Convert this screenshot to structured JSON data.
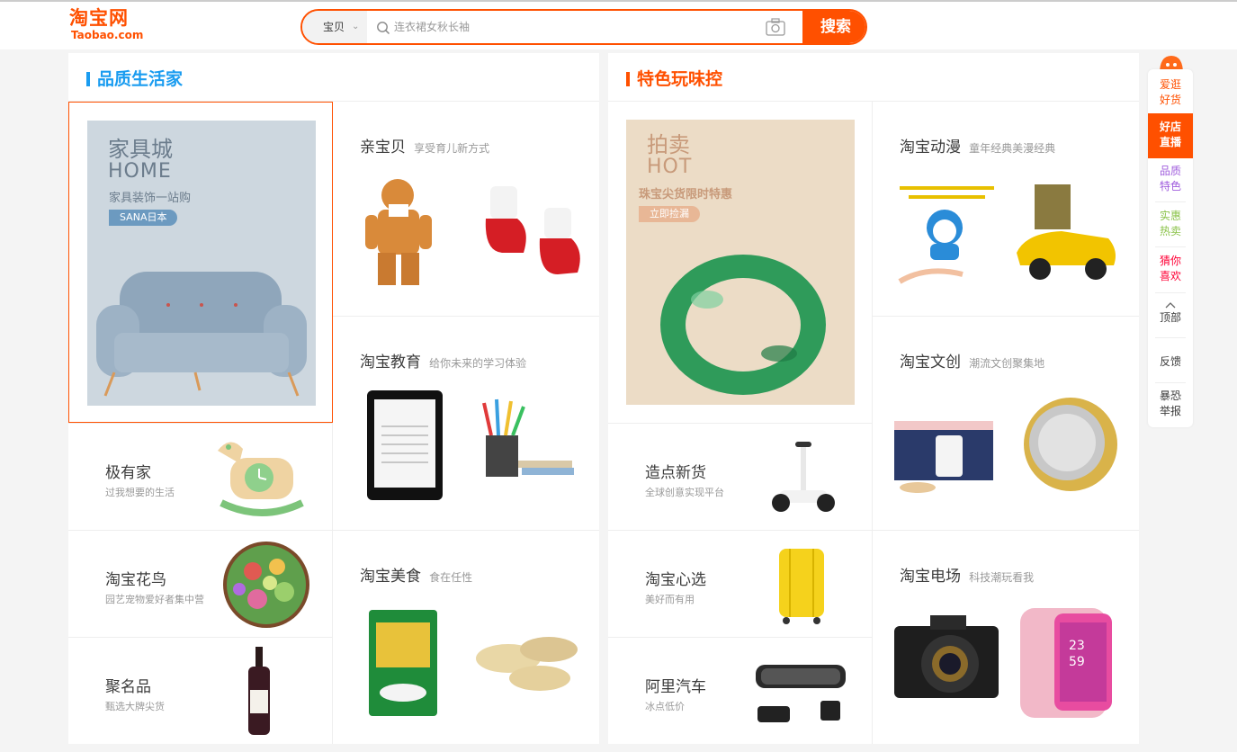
{
  "header": {
    "logo_cn": "淘宝网",
    "logo_en": "Taobao.com",
    "search_type": "宝贝",
    "search_placeholder": "连衣裙女秋长袖",
    "search_button": "搜索"
  },
  "left_panel": {
    "title": "品质生活家",
    "feature": {
      "big": "家具城",
      "en": "HOME",
      "sub": "家具装饰一站购",
      "tag": "SANA日本"
    },
    "rows": [
      {
        "title": "极有家",
        "sub": "过我想要的生活"
      },
      {
        "title": "淘宝花鸟",
        "sub": "园艺宠物爱好者集中营"
      },
      {
        "title": "聚名品",
        "sub": "甄选大牌尖货"
      }
    ],
    "cells": [
      {
        "title": "亲宝贝",
        "sub": "享受育儿新方式"
      },
      {
        "title": "淘宝教育",
        "sub": "给你未来的学习体验"
      },
      {
        "title": "淘宝美食",
        "sub": "食在任性"
      }
    ]
  },
  "right_panel": {
    "title": "特色玩味控",
    "feature": {
      "big": "拍卖",
      "en": "HOT",
      "sub": "珠宝尖货限时特惠",
      "tag": "立即捡漏"
    },
    "rows": [
      {
        "title": "造点新货",
        "sub": "全球创意实现平台"
      },
      {
        "title": "淘宝心选",
        "sub": "美好而有用"
      },
      {
        "title": "阿里汽车",
        "sub": "冰点低价"
      }
    ],
    "cells": [
      {
        "title": "淘宝动漫",
        "sub": "童年经典美漫经典"
      },
      {
        "title": "淘宝文创",
        "sub": "潮流文创聚集地"
      },
      {
        "title": "淘宝电场",
        "sub": "科技潮玩看我"
      }
    ]
  },
  "sidebar": {
    "items": [
      {
        "l1": "爱逛",
        "l2": "好货",
        "color": "#ff5000"
      },
      {
        "l1": "好店",
        "l2": "直播",
        "color": "#ffffff"
      },
      {
        "l1": "品质",
        "l2": "特色",
        "color": "#a05ddd"
      },
      {
        "l1": "实惠",
        "l2": "热卖",
        "color": "#8bc34a"
      },
      {
        "l1": "猜你",
        "l2": "喜欢",
        "color": "#ff0036"
      }
    ],
    "top": "顶部",
    "feedback": "反馈",
    "report_l1": "暴恐",
    "report_l2": "举报"
  },
  "colors": {
    "brand": "#ff5000",
    "left_accent": "#1a9cf0"
  }
}
